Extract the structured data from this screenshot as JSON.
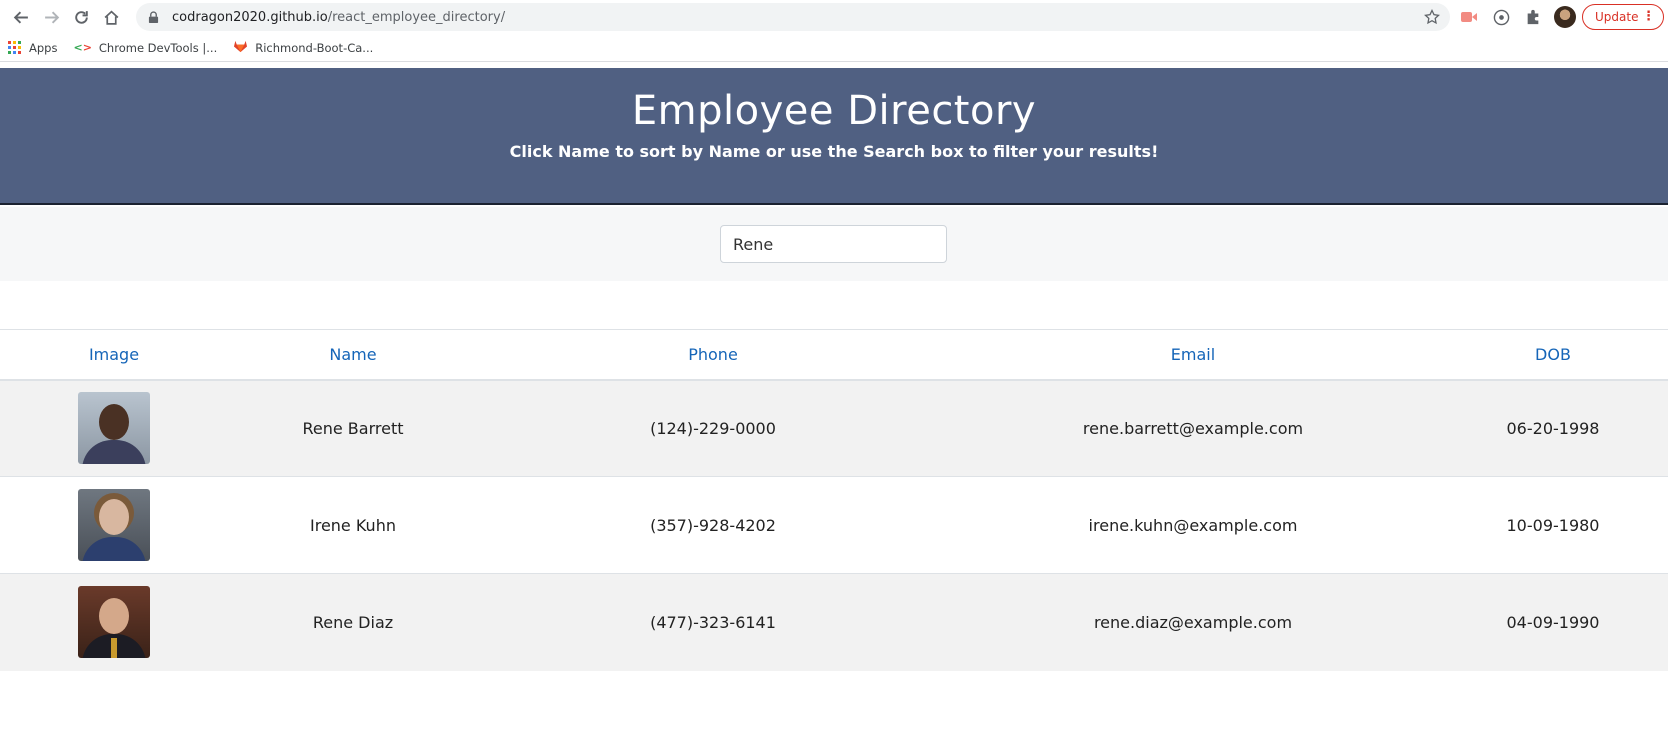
{
  "browser": {
    "url_host": "codragon2020.github.io",
    "url_path": "/react_employee_directory/",
    "update_label": "Update",
    "bookmarks": [
      {
        "label": "Apps",
        "icon": "apps-grid-icon"
      },
      {
        "label": "Chrome DevTools |...",
        "icon": "devtools-icon"
      },
      {
        "label": "Richmond-Boot-Ca...",
        "icon": "gitlab-icon"
      }
    ]
  },
  "header": {
    "title": "Employee Directory",
    "subtitle": "Click Name to sort by Name or use the Search box to filter your results!"
  },
  "search": {
    "value": "Rene"
  },
  "table": {
    "columns": [
      "Image",
      "Name",
      "Phone",
      "Email",
      "DOB"
    ],
    "rows": [
      {
        "name": "Rene Barrett",
        "phone": "(124)-229-0000",
        "email": "rene.barrett@example.com",
        "dob": "06-20-1998"
      },
      {
        "name": "Irene Kuhn",
        "phone": "(357)-928-4202",
        "email": "irene.kuhn@example.com",
        "dob": "10-09-1980"
      },
      {
        "name": "Rene Diaz",
        "phone": "(477)-323-6141",
        "email": "rene.diaz@example.com",
        "dob": "04-09-1990"
      }
    ]
  },
  "colors": {
    "header_bg": "#506082",
    "link_blue": "#1565b8",
    "row_stripe": "#f2f2f2",
    "update_red": "#d93025"
  }
}
